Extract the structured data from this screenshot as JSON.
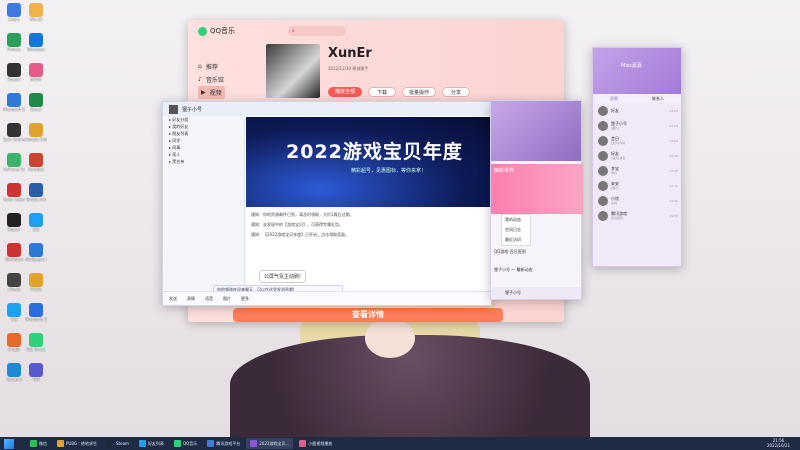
{
  "desktop": {
    "icons": [
      "Users",
      "Win10",
      "Photos",
      "Windows",
      "Steam",
      "bilibili",
      "Microsoft Edge",
      "Excel",
      "Epic Games Launcher",
      "Google Chrome",
      "GeForce Experience",
      "Acrobat",
      "Apex Legends",
      "Battle.net",
      "Steam",
      "QQ",
      "WeGame",
      "Wallpaper Engine",
      "uTools",
      "PUBG",
      "QQ",
      "Microsoft Store",
      "Origin",
      "QQ Music",
      "Tencent",
      "TIM"
    ]
  },
  "music": {
    "app": "QQ音乐",
    "nav": [
      "推荐",
      "音乐馆",
      "视频"
    ],
    "artist": "XunEr",
    "desc": "2012/12/30  原创歌手",
    "play": "播放全部",
    "download": "下载",
    "collect": "批量操作",
    "share": "分享",
    "ad": "查看详情"
  },
  "chat": {
    "title": "狸子小号",
    "side_rows": [
      "好友分组",
      "我的好友",
      "朋友列表",
      "同学",
      "同事",
      "家人",
      "黑名单"
    ],
    "banner_title": "2022游戏宝贝年度",
    "banner_sub": "精彩超号，见惠图标，等你来拿！",
    "messages": [
      "通知：你的资源邮件已到，请及时领取，大约1周后过期。",
      "通知：去发现中的【游戏宝贝】，可获得专属礼包。",
      "通知：【2022游戏宝贝年度】已开启，点击领取奖励。"
    ],
    "bubble": "公屏气氛主动刷!",
    "input": "你的频道欢迎来聊天，可以在这里发消息哦!",
    "bottom": [
      "发送",
      "表情",
      "语音",
      "图片",
      "更多"
    ]
  },
  "panel": {
    "game_label": "精彩世界",
    "menu": [
      "我的动态",
      "空间日志",
      "最近访问"
    ],
    "items": [
      "QQ游戏-百日签到",
      "狸子小号 — 最新动态"
    ],
    "foot": "狸子小号"
  },
  "friends": {
    "user": "Miss嘉嘉",
    "tabs": [
      "消息",
      "联系人"
    ],
    "rows": [
      {
        "name": "好友",
        "sub": "",
        "time": "13:05"
      },
      {
        "name": "狸子小号",
        "sub": "[图片]",
        "time": "13:04"
      },
      {
        "name": "昔日",
        "sub": "[文件]你好",
        "time": "13:02"
      },
      {
        "name": "好友",
        "sub": "[语音]消息",
        "time": "12:49"
      },
      {
        "name": "李宝",
        "sub": "你好",
        "time": "12:40"
      },
      {
        "name": "安安",
        "sub": "[图片]",
        "time": "12:31"
      },
      {
        "name": "小欣",
        "sub": "在吗",
        "time": "12:20"
      },
      {
        "name": "腾讯游戏",
        "sub": "活动通知",
        "time": "11:58"
      }
    ]
  },
  "taskbar": {
    "items": [
      "微信",
      "PUBG : 绝地求生",
      "Steam",
      "好友列表",
      "QQ音乐",
      "腾讯游戏平台",
      "2022游戏宝贝...",
      "小鹿视频播放"
    ],
    "active_index": 6,
    "time": "21:56",
    "date": "2022/10/21"
  }
}
